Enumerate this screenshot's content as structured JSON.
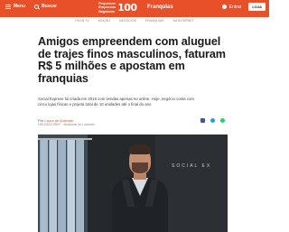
{
  "header": {
    "menu_label": "Menu",
    "search_label": "Buscar",
    "brand_line1": "Pequenas",
    "brand_line2": "Empresas",
    "brand_line3": "Negócios",
    "brand_number": "100",
    "section": "Franquias",
    "login_label": "Entrar",
    "store_label": "LOJA",
    "accent_color": "#e8502a"
  },
  "subnav": {
    "items": [
      "PEGN TV",
      "EDIÇÃO",
      "NEGÓCIOS",
      "FRANQUIAS",
      "NA INTERNET"
    ]
  },
  "article": {
    "headline": "Amigos empreendem com aluguel de trajes finos masculinos, faturam R$ 5 milhões e apostam em franquias",
    "summary": "Social Express foi criada em 2016 com vendas apenas no online. Hoje, negócio conta com cinco lojas físicas e projeta total de 10 unidades até o final do ano",
    "byline_prefix": "Por",
    "author": "Laura de Andrade",
    "dates": "19/04/2023 09h07 · Atualizado há 1 semana",
    "photo_wall_text": "SOCIAL EX"
  },
  "share": {
    "icons": [
      "facebook-icon",
      "twitter-icon",
      "whatsapp-icon"
    ]
  }
}
